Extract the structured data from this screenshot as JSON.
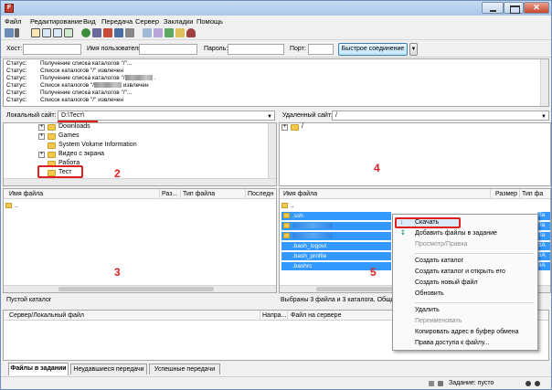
{
  "menubar": {
    "items": [
      "Файл",
      "Редактирование",
      "Вид",
      "Передача",
      "Сервер",
      "Закладки",
      "Помощь"
    ]
  },
  "quickconnect": {
    "host_label": "Хост:",
    "user_label": "Имя пользователя",
    "password_label": "Пароль:",
    "port_label": "Порт:",
    "connect_button": "Быстрое соединение",
    "dropdown_icon": "chevron-down-icon"
  },
  "log": {
    "rows": [
      {
        "label": "Статус:",
        "message": "Получение списка каталогов \"/\"..."
      },
      {
        "label": "Статус:",
        "message": "Список каталогов \"/\" извлечен"
      },
      {
        "label": "Статус:",
        "message": "Получение списка каталогов \"/"
      },
      {
        "label": "Статус:",
        "message": "Список каталогов \"/",
        "suffix": "извлечен"
      },
      {
        "label": "Статус:",
        "message": "Получение списка каталогов \"/\"..."
      },
      {
        "label": "Статус:",
        "message": "Список каталогов \"/\" извлечен"
      }
    ]
  },
  "local": {
    "site_label": "Локальный сайт:",
    "path": "D:\\Тест\\",
    "tree": [
      {
        "name": "Downloads",
        "expander": "+"
      },
      {
        "name": "Games",
        "expander": "+"
      },
      {
        "name": "System Volume Information",
        "expander": ""
      },
      {
        "name": "Видео с экрана",
        "expander": "+"
      },
      {
        "name": "Работа",
        "expander": ""
      },
      {
        "name": "Тест",
        "expander": ""
      }
    ],
    "columns": {
      "name": "Имя файла",
      "size": "Раз...",
      "type": "Тип файла",
      "modified": "Последн"
    },
    "files": [
      ".."
    ],
    "status": "Пустой каталог"
  },
  "remote": {
    "site_label": "Удаленный сайт:",
    "path": "/",
    "tree": [
      {
        "name": "/",
        "expander": "+"
      }
    ],
    "columns": {
      "name": "Имя файла",
      "size": "Размер",
      "type": "Тип фа"
    },
    "files": [
      {
        "name": "..",
        "selected": false
      },
      {
        "name": ".ssh",
        "selected": true
      },
      {
        "name": "",
        "selected": true,
        "redacted": true
      },
      {
        "name": "",
        "selected": true,
        "redacted": true
      },
      {
        "name": ".bash_logout",
        "selected": true
      },
      {
        "name": ".bash_profile",
        "selected": true
      },
      {
        "name": ".bashrc",
        "selected": true
      }
    ],
    "type_prefixes": [
      "Па",
      "Па",
      "Па",
      "BA",
      "BA",
      "BA"
    ],
    "status": "Выбраны 3 файла и 3 каталога. Общий ра"
  },
  "context_menu": {
    "items": [
      {
        "label": "Скачать",
        "icon": "download-arrow-icon",
        "disabled": false,
        "highlighted": true
      },
      {
        "label": "Добавить файлы в задание",
        "icon": "queue-add-icon",
        "disabled": false
      },
      {
        "label": "Просмотр/Правка",
        "disabled": true
      },
      {
        "separator": true
      },
      {
        "label": "Создать каталог",
        "disabled": false
      },
      {
        "label": "Создать каталог и открыть его",
        "disabled": false
      },
      {
        "label": "Создать новый файл",
        "disabled": false
      },
      {
        "label": "Обновить",
        "disabled": false
      },
      {
        "separator": true
      },
      {
        "label": "Удалить",
        "disabled": false
      },
      {
        "label": "Переименовать",
        "disabled": true
      },
      {
        "label": "Копировать адрес в буфер обмена",
        "disabled": false
      },
      {
        "label": "Права доступа к файлу...",
        "disabled": false
      }
    ]
  },
  "queue": {
    "columns": [
      "Сервер/Локальный файл",
      "Напра...",
      "Файл на сервере"
    ]
  },
  "tabs": [
    "Файлы в задании",
    "Неудавшиеся передачи",
    "Успешные передачи"
  ],
  "statusbar": {
    "text": "Задание: пусто"
  },
  "annotations": {
    "label_2": "2",
    "label_3": "3",
    "label_4": "4",
    "label_5": "5",
    "accent_color": "#e02020"
  },
  "colors": {
    "selection": "#3399ff",
    "folder": "#f2c94c",
    "titlebar": "#a9c7ea"
  }
}
